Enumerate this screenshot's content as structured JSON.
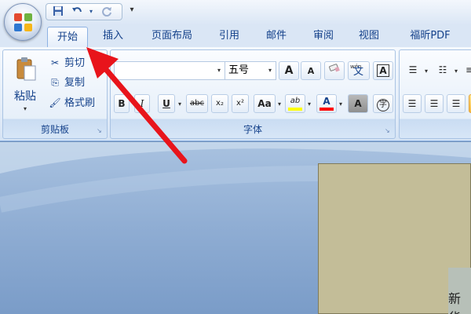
{
  "quick_access": {
    "save_icon": "save-icon",
    "undo_icon": "undo-icon",
    "redo_icon": "redo-icon",
    "customize_icon": "customize-toolbar-icon"
  },
  "tabs": [
    {
      "label": "开始",
      "active": true
    },
    {
      "label": "插入"
    },
    {
      "label": "页面布局"
    },
    {
      "label": "引用"
    },
    {
      "label": "邮件"
    },
    {
      "label": "审阅"
    },
    {
      "label": "视图"
    },
    {
      "label": "福昕PDF"
    }
  ],
  "clipboard": {
    "group_label": "剪贴板",
    "paste_label": "粘贴",
    "cut_label": "剪切",
    "copy_label": "复制",
    "format_painter_label": "格式刷"
  },
  "font": {
    "group_label": "字体",
    "font_name_value": "",
    "font_size_value": "五号",
    "grow_icon": "A",
    "shrink_icon": "A",
    "phonetic_icon": "wén",
    "border_icon": "A",
    "bold": "B",
    "italic": "I",
    "underline": "U",
    "strike": "abc",
    "subscript": "x₂",
    "superscript": "x²",
    "change_case": "Aa",
    "highlight_icon": "ab",
    "font_color_icon": "A",
    "shading_icon": "A",
    "enclose_icon": "字"
  },
  "document": {
    "visible_text": "新华"
  },
  "colors": {
    "highlight": "#ffff00",
    "font_color": "#ff0000",
    "arrow": "#e8141b"
  }
}
